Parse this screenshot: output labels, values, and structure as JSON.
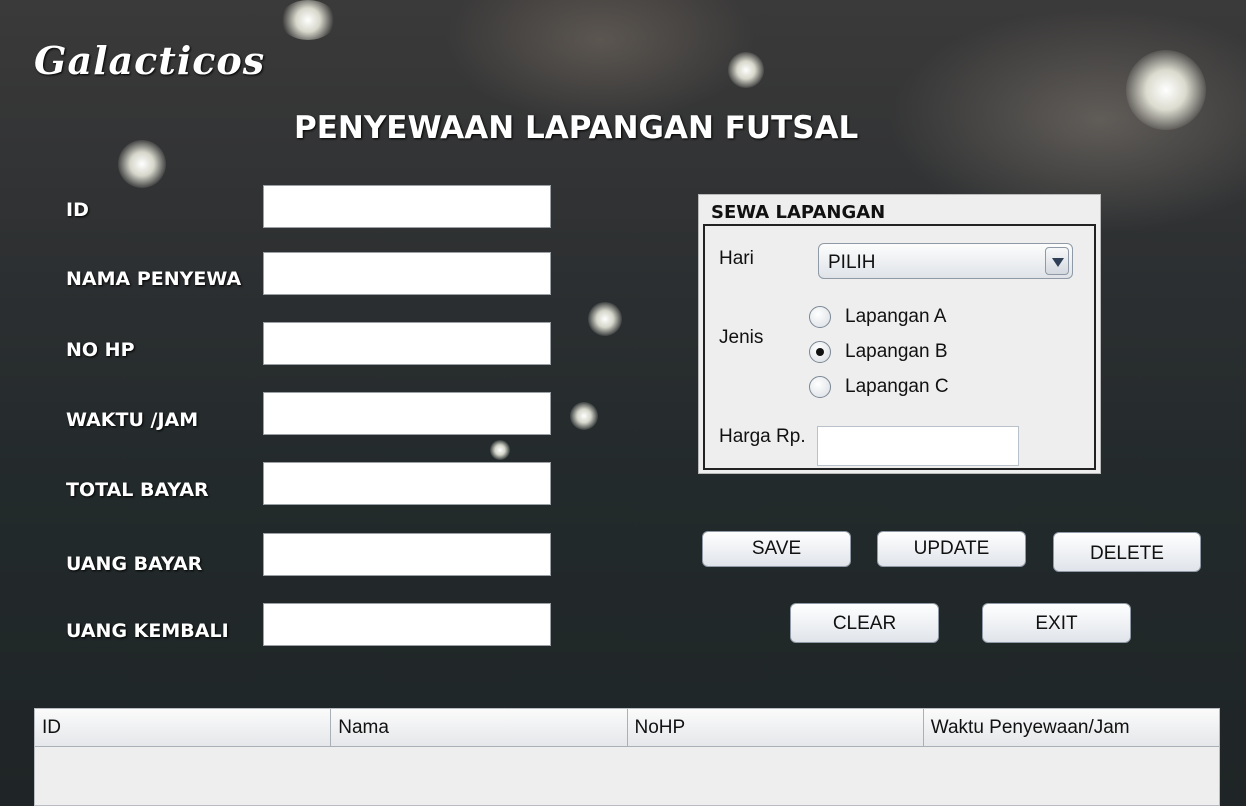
{
  "app": {
    "logo": "Galacticos",
    "title": "PENYEWAAN LAPANGAN FUTSAL"
  },
  "form": {
    "fields": [
      {
        "label": "ID",
        "value": ""
      },
      {
        "label": "NAMA PENYEWA",
        "value": ""
      },
      {
        "label": "NO HP",
        "value": ""
      },
      {
        "label": "WAKTU /JAM",
        "value": ""
      },
      {
        "label": "TOTAL BAYAR",
        "value": ""
      },
      {
        "label": "UANG BAYAR",
        "value": ""
      },
      {
        "label": "UANG KEMBALI",
        "value": ""
      }
    ]
  },
  "rental_panel": {
    "title": "SEWA LAPANGAN",
    "day_label": "Hari",
    "day_selected": "PILIH",
    "type_label": "Jenis",
    "options": [
      {
        "label": "Lapangan A",
        "checked": false
      },
      {
        "label": "Lapangan B",
        "checked": true
      },
      {
        "label": "Lapangan C",
        "checked": false
      }
    ],
    "price_label": "Harga Rp.",
    "price_value": ""
  },
  "buttons": {
    "save": "SAVE",
    "update": "UPDATE",
    "delete": "DELETE",
    "clear": "CLEAR",
    "exit": "EXIT"
  },
  "table": {
    "columns": [
      "ID",
      "Nama",
      "NoHP",
      "Waktu Penyewaan/Jam"
    ],
    "rows": []
  }
}
